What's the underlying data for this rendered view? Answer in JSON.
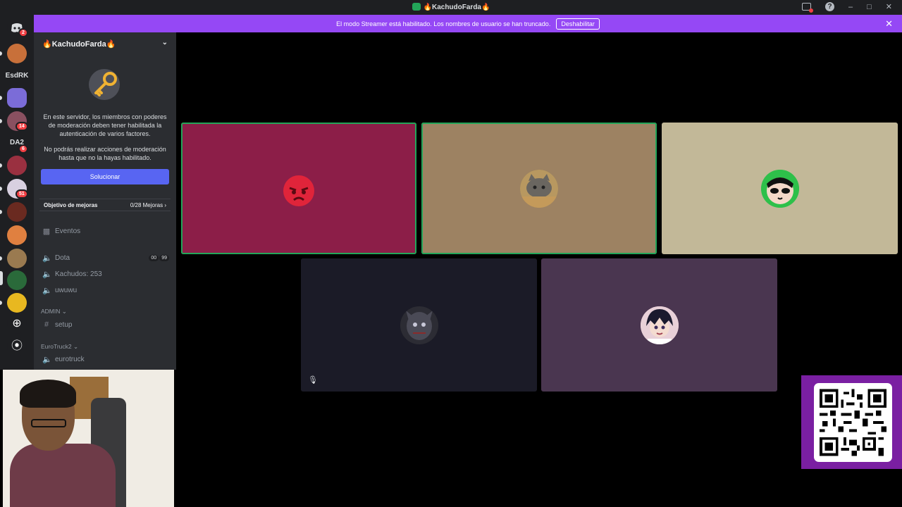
{
  "window": {
    "title": "🔥KachudoFarda🔥"
  },
  "banner": {
    "message": "El modo Streamer está habilitado. Los nombres de usuario se han truncado.",
    "button_label": "Deshabilitar"
  },
  "rail": {
    "home_badge": "2",
    "text_servers": [
      "EsdRK",
      "DA2"
    ],
    "badges": [
      "14",
      "6",
      "51"
    ]
  },
  "server": {
    "name": "🔥KachudoFarda🔥",
    "mfa_notice_1": "En este servidor, los miembros con poderes de moderación deben tener habilitada la autenticación de varios factores.",
    "mfa_notice_2": "No podrás realizar acciones de moderación hasta que no la hayas habilitado.",
    "fix_button": "Solucionar",
    "boost_label": "Objetivo de mejoras",
    "boost_progress": "0/28 Mejoras",
    "events_label": "Eventos",
    "channels": {
      "dota": "Dota",
      "dota_count_a": "00",
      "dota_count_b": "99",
      "kachudos": "Kachudos: 253",
      "uwuwu": "uwuwu",
      "cat_admin": "ADMIN",
      "setup": "setup",
      "cat_eurotruck": "EuroTruck2",
      "eurotruck": "eurotruck"
    }
  },
  "colors": {
    "banner": "#9548f5",
    "speaking": "#23a559",
    "tile1": "#8c1e48",
    "tile2": "#9d8262",
    "tile3": "#c2b898",
    "tile4": "#1b1b27",
    "tile5": "#4a3650",
    "qr_bg": "#7a1fa2"
  },
  "icons": {
    "discord_home": "discord-logo-icon",
    "add_server": "plus-icon",
    "discover": "compass-icon",
    "events": "calendar-icon",
    "voice": "speaker-icon",
    "text": "hash-icon",
    "mute": "muted-mic-icon",
    "help": "help-icon",
    "inbox": "inbox-icon"
  }
}
